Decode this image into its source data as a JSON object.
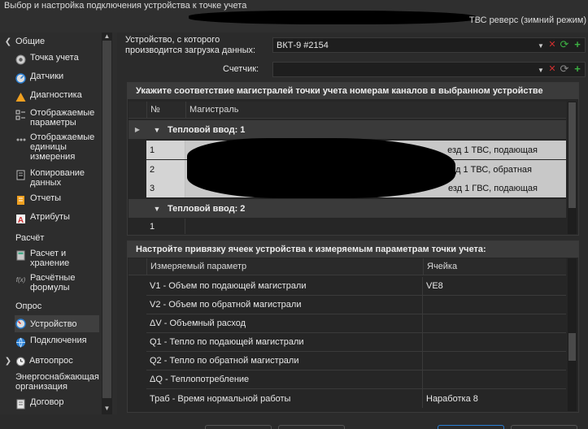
{
  "window": {
    "title": "Выбор и настройка подключения устройства к точке учета",
    "title_right": "ТВС реверс (зимний режим)"
  },
  "sidebar": {
    "groups": [
      {
        "label": "Общие"
      },
      {
        "label": "Расчёт"
      },
      {
        "label": "Опрос"
      },
      {
        "label": "Автоопрос"
      },
      {
        "label": "Энергоснабжающая организация"
      }
    ],
    "items": [
      {
        "label": "Точка учета",
        "icon": "point-icon"
      },
      {
        "label": "Датчики",
        "icon": "sensor-icon"
      },
      {
        "label": "Диагностика",
        "icon": "warning-icon"
      },
      {
        "label": "Отображаемые параметры",
        "icon": "checklist-icon"
      },
      {
        "label": "Отображаемые единицы измерения",
        "icon": "units-icon"
      },
      {
        "label": "Копирование данных",
        "icon": "copy-icon"
      },
      {
        "label": "Отчеты",
        "icon": "report-icon"
      },
      {
        "label": "Атрибуты",
        "icon": "attribute-icon"
      },
      {
        "label": "Расчет и хранение",
        "icon": "calculator-icon"
      },
      {
        "label": "Расчётные формулы",
        "icon": "formula-icon"
      },
      {
        "label": "Устройство",
        "icon": "device-icon"
      },
      {
        "label": "Подключения",
        "icon": "connection-icon"
      },
      {
        "label": "Договор",
        "icon": "contract-icon"
      }
    ],
    "formula_glyph": "f(x)"
  },
  "form": {
    "device_label": "Устройство, с которого производится загрузка данных:",
    "device_value": "ВКТ-9 #2154",
    "meter_label": "Счетчик:",
    "meter_value": ""
  },
  "channels": {
    "title": "Укажите соответствие магистралей точки учета номерам каналов в выбранном устройстве",
    "col_no": "№",
    "col_main": "Магистраль",
    "group1": "Тепловой ввод: 1",
    "group2": "Тепловой ввод: 2",
    "rows": [
      {
        "no": "1",
        "main": "езд 1 ТВС, подающая"
      },
      {
        "no": "2",
        "main": "езд 1 ТВС, обратная"
      },
      {
        "no": "3",
        "main": "езд 1 ГВС, подающая"
      }
    ],
    "group2_rows": [
      {
        "no": "1"
      }
    ]
  },
  "cells": {
    "title": "Настройте привязку ячеек устройства к измеряемым параметрам точки учета:",
    "col_param": "Измеряемый параметр",
    "col_cell": "Ячейка",
    "rows": [
      {
        "param": "V1 - Объем по подающей магистрали",
        "cell": "VE8"
      },
      {
        "param": "V2 - Объем по обратной магистрали",
        "cell": ""
      },
      {
        "param": "ΔV - Объемный расход",
        "cell": ""
      },
      {
        "param": "Q1 - Тепло по подающей магистрали",
        "cell": ""
      },
      {
        "param": "Q2 - Тепло по обратной магистрали",
        "cell": ""
      },
      {
        "param": "ΔQ - Теплопотребление",
        "cell": ""
      },
      {
        "param": "Траб - Время нормальной работы",
        "cell": "Наработка 8"
      }
    ]
  },
  "colors": {
    "accent": "#2a7fd4",
    "ok_green": "#3cb043",
    "warn_orange": "#f0a020",
    "del_red": "#d03030"
  }
}
